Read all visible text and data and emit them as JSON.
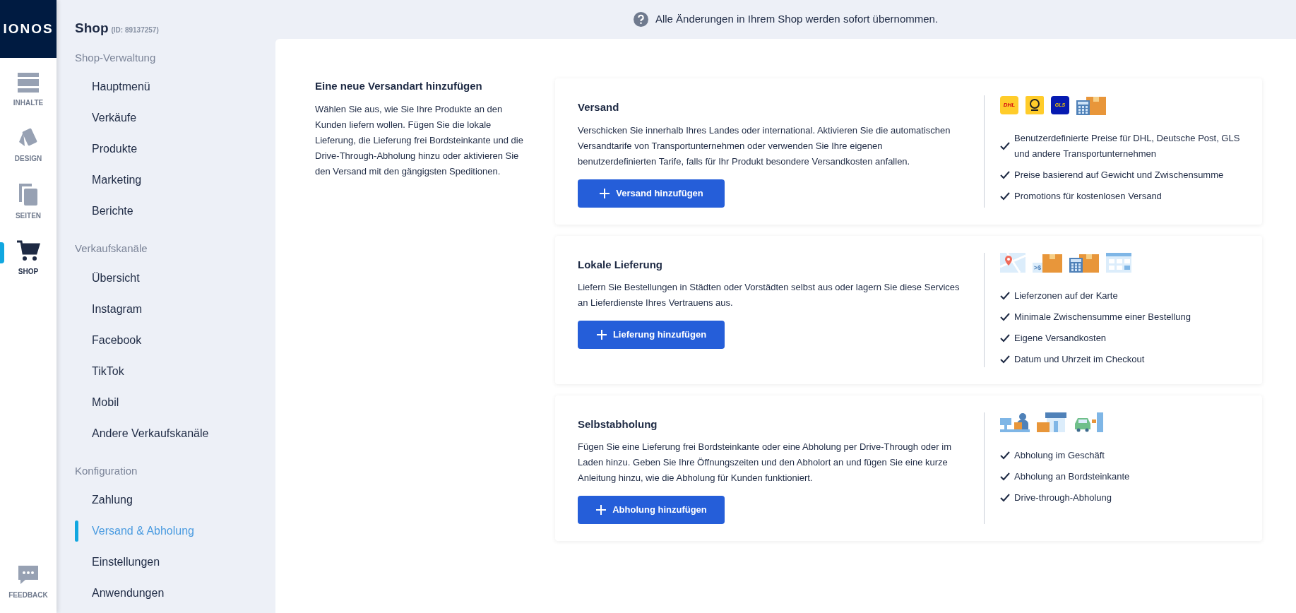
{
  "rail": {
    "logo": "IONOS",
    "items": [
      {
        "kind": "content",
        "label": "INHALTE",
        "selected": false
      },
      {
        "kind": "design",
        "label": "DESIGN",
        "selected": false
      },
      {
        "kind": "pages",
        "label": "SEITEN",
        "selected": false
      },
      {
        "kind": "shop",
        "label": "SHOP",
        "selected": true
      }
    ],
    "feedback": {
      "label": "FEEDBACK"
    }
  },
  "sidebar": {
    "title": "Shop",
    "id": "(ID: 89137257)",
    "sections": [
      {
        "heading": "Shop-Verwaltung",
        "items": [
          {
            "label": "Hauptmenü",
            "selected": false
          },
          {
            "label": "Verkäufe",
            "selected": false
          },
          {
            "label": "Produkte",
            "selected": false
          },
          {
            "label": "Marketing",
            "selected": false
          },
          {
            "label": "Berichte",
            "selected": false
          }
        ]
      },
      {
        "heading": "Verkaufskanäle",
        "items": [
          {
            "label": "Übersicht",
            "selected": false
          },
          {
            "label": "Instagram",
            "selected": false
          },
          {
            "label": "Facebook",
            "selected": false
          },
          {
            "label": "TikTok",
            "selected": false
          },
          {
            "label": "Mobil",
            "selected": false
          },
          {
            "label": "Andere Verkaufskanäle",
            "selected": false
          }
        ]
      },
      {
        "heading": "Konfiguration",
        "items": [
          {
            "label": "Zahlung",
            "selected": false
          },
          {
            "label": "Versand & Abholung",
            "selected": true
          },
          {
            "label": "Einstellungen",
            "selected": false
          },
          {
            "label": "Anwendungen",
            "selected": false
          }
        ]
      }
    ]
  },
  "notice": "Alle Änderungen in Ihrem Shop werden sofort übernommen.",
  "intro": {
    "title": "Eine neue Versandart hinzufügen",
    "text": "Wählen Sie aus, wie Sie Ihre Produkte an den Kunden liefern wollen. Fügen Sie die lokale Lieferung, die Lieferung frei Bordsteinkante und die Drive-Through-Abholung hinzu oder aktivieren Sie den Versand mit den gängigsten Speditionen."
  },
  "cards": [
    {
      "title": "Versand",
      "text": "Verschicken Sie innerhalb Ihres Landes oder international. Aktivieren Sie die automatischen Versandtarife von Transportunternehmen oder verwenden Sie Ihre eigenen benutzerdefinierten Tarife, falls für Ihr Produkt besondere Versandkosten anfallen.",
      "button": "Versand hinzufügen",
      "icons": [
        {
          "kind": "dhl",
          "text": "DHL"
        },
        {
          "kind": "post"
        },
        {
          "kind": "gls",
          "text": "GLS"
        },
        {
          "kind": "calc-box"
        }
      ],
      "features": [
        "Benutzerdefinierte Preise für DHL, Deutsche Post, GLS und andere Transportunternehmen",
        "Preise basierend auf Gewicht und Zwischensumme",
        "Promotions für kostenlosen Versand"
      ]
    },
    {
      "title": "Lokale Lieferung",
      "text": "Liefern Sie Bestellungen in Städten oder Vorstädten selbst aus oder lagern Sie diese Services an Lieferdienste Ihres Vertrauens aus.",
      "button": "Lieferung hinzufügen",
      "icons": [
        {
          "kind": "map"
        },
        {
          "kind": "price-box",
          "text": ">$"
        },
        {
          "kind": "calc-box"
        },
        {
          "kind": "calendar"
        }
      ],
      "features": [
        "Lieferzonen auf der Karte",
        "Minimale Zwischensumme einer Bestellung",
        "Eigene Versandkosten",
        "Datum und Uhrzeit im Checkout"
      ]
    },
    {
      "title": "Selbstabholung",
      "text": "Fügen Sie eine Lieferung frei Bordsteinkante oder eine Abholung per Drive-Through oder im Laden hinzu. Geben Sie Ihre Öffnungszeiten und den Abholort an und fügen Sie eine kurze Anleitung hinzu, wie die Abholung für Kunden funktioniert.",
      "button": "Abholung hinzufügen",
      "icons": [
        {
          "kind": "counter"
        },
        {
          "kind": "store"
        },
        {
          "kind": "drive"
        }
      ],
      "features": [
        "Abholung im Geschäft",
        "Abholung an Bordsteinkante",
        "Drive-through-Abholung"
      ]
    }
  ]
}
